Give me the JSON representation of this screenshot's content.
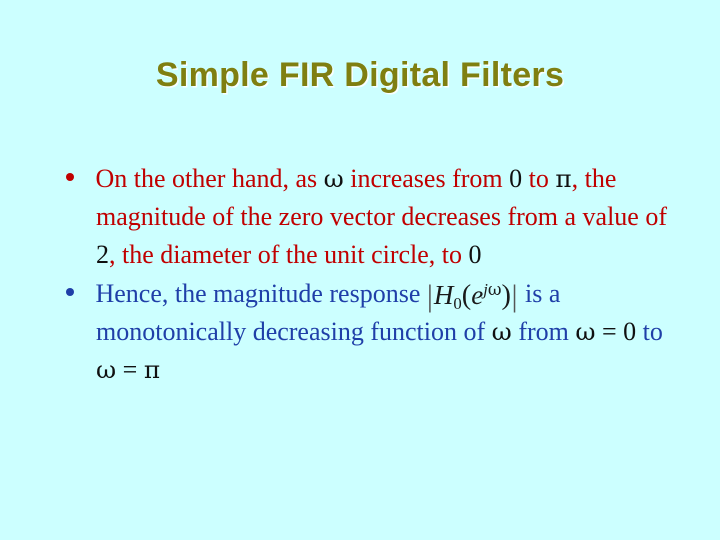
{
  "slide": {
    "background_color": "#ccffff",
    "title": "Simple FIR Digital Filters",
    "title_color": "#7f7f11"
  },
  "bullets": [
    {
      "marker": "round-bullet",
      "color": "#c00000",
      "symbol_color": "#101010",
      "text_plain": "On the other hand, as ω increases from 0 to π, the magnitude of the zero vector decreases from a value of 2, the diameter of the unit circle, to 0",
      "segments": {
        "s1": "On the other hand, as ",
        "s2": "ω",
        "s3": " increases from ",
        "s4": "0",
        "s5": " to ",
        "s6": "π",
        "s7": ", the magnitude of the zero vector decreases from a value of ",
        "s8": "2",
        "s9": ", the diameter of the unit circle, to ",
        "s10": "0"
      }
    },
    {
      "marker": "round-bullet",
      "color": "#1f3fa8",
      "symbol_color": "#101010",
      "text_plain": "Hence, the magnitude response |H0(e^jω)| is a monotonically decreasing function of ω from ω = 0 to ω = π",
      "segments": {
        "s1": "Hence, the magnitude response ",
        "s2": " is a monotonically decreasing function of ",
        "s3": "ω",
        "s4": " from ",
        "s5": "ω",
        "s6": " = ",
        "s7": "0",
        "s8": " to ",
        "s9": "ω",
        "s10": " = ",
        "s11": "π"
      },
      "equation": {
        "label": "magnitude-response-H0",
        "left_bar": "|",
        "base": "H",
        "subscript": "0",
        "open_paren": "(",
        "exp_base": "e",
        "exp_j": "j",
        "exp_omega": "ω",
        "close_paren": ")",
        "right_bar": "|"
      }
    }
  ]
}
